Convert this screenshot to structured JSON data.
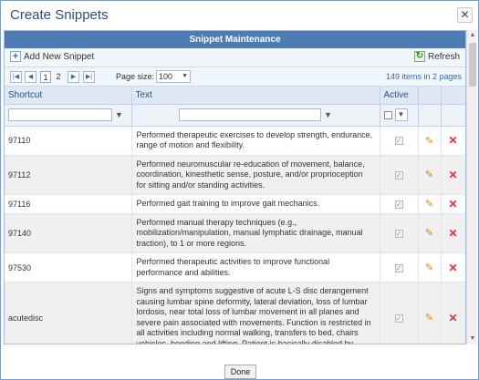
{
  "dialog": {
    "title": "Create Snippets",
    "close_symbol": "✕",
    "done_label": "Done"
  },
  "panel": {
    "header": "Snippet Maintenance"
  },
  "toolbar": {
    "add_label": "Add New Snippet",
    "add_icon": "plus-icon",
    "refresh_label": "Refresh",
    "refresh_icon": "refresh-icon"
  },
  "pager": {
    "pages": [
      "1",
      "2"
    ],
    "current_page": "1",
    "page_size_label": "Page size:",
    "page_size": "100",
    "info": "149 items in 2 pages"
  },
  "grid": {
    "columns": {
      "shortcut": "Shortcut",
      "text": "Text",
      "active": "Active"
    },
    "rows": [
      {
        "shortcut": "97110",
        "text": "Performed therapeutic exercises to develop strength, endurance, range of motion and flexibility.",
        "active": true
      },
      {
        "shortcut": "97112",
        "text": "Performed neuromuscular re-education of movement, balance, coordination, kinesthetic sense, posture, and/or proprioception for sitting and/or standing activities.",
        "active": true
      },
      {
        "shortcut": "97116",
        "text": "Performed gait training to improve gait mechanics.",
        "active": true
      },
      {
        "shortcut": "97140",
        "text": "Performed manual therapy techniques (e.g., mobilization/manipulation, manual lymphatic drainage, manual traction), to 1 or more regions.",
        "active": true
      },
      {
        "shortcut": "97530",
        "text": "Performed therapeutic activities to improve functional performance and abilities.",
        "active": true
      },
      {
        "shortcut": "acutedisc",
        "text": "Signs and symptoms suggestive of acute L-S disc derangement causing lumbar spine deformity, lateral deviation, loss of lumbar lordosis, near total loss of lumbar movement in all planes and severe pain associated with movements. Function is restricted in all activities including normal walking, transfers to bed, chairs vehicles, bending and lifting. Patient is basically disabled by",
        "active": true
      }
    ]
  },
  "colors": {
    "header_bg": "#4d7cb5",
    "title": "#2b4f7e",
    "edit": "#d48a10",
    "delete": "#e03030"
  }
}
